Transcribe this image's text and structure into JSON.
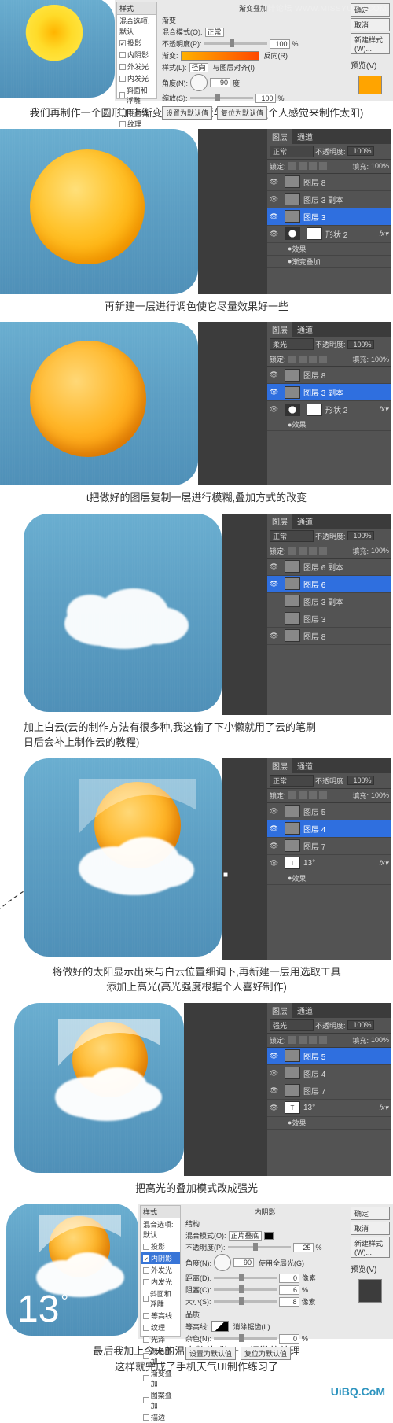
{
  "watermark": "思缘设计论坛  WWW.MISSYUAN.COM",
  "footer_site": "UiBQ.CoM",
  "captions": {
    "c1": "我们再制作一个圆形加上渐变色使它接近与太阳颜色(个人感觉来制作太阳)",
    "c2": "再新建一层进行调色使它尽量效果好一些",
    "c3": "t把做好的图层复制一层进行模糊,叠加方式的改变",
    "c4a": "加上白云(云的制作方法有很多种,我这偷了下小懒就用了云的笔刷",
    "c4b": "日后会补上制作云的教程)",
    "c5a": "将做好的太阳显示出来与白云位置细调下,再新建一层用选取工具",
    "c5b": "添加上高光(高光强度根据个人喜好制作)",
    "c6": "把高光的叠加模式改成强光",
    "c7a": "最后我加上今天的温度数值,做一下细微的处理",
    "c7b": "这样就完成了手机天气UI制作练习了"
  },
  "temp_value": "13",
  "style_panel": {
    "col_header": "样式",
    "group_header": "混合选项:默认",
    "items": [
      "投影",
      "内阴影",
      "外发光",
      "内发光",
      "斜面和浮雕",
      "等高线",
      "纹理",
      "光泽",
      "颜色叠加",
      "渐变叠加",
      "图案叠加",
      "描边"
    ],
    "checked": [
      true,
      false,
      false,
      false,
      false,
      false,
      false,
      false,
      false,
      true,
      false,
      false
    ],
    "selected_index": 9,
    "title_gradient": "渐变叠加",
    "section_gradient": "渐变",
    "blend_label": "混合模式(O):",
    "blend_value": "正常",
    "opacity_label": "不透明度(P):",
    "opacity_value": "100",
    "gradient_label": "渐变:",
    "reverse_label": "反向(R)",
    "style_label": "样式(L):",
    "style_value": "径向",
    "align_label": "与图层对齐(I)",
    "angle_label": "角度(N):",
    "angle_value": "90",
    "angle_unit": "度",
    "scale_label": "缩放(S):",
    "scale_value": "100",
    "btn_default": "设置为默认值",
    "btn_reset": "复位为默认值",
    "side_ok": "确定",
    "side_cancel": "取消",
    "side_new": "新建样式(W)...",
    "side_preview": "预览(V)",
    "title_innershadow": "内阴影",
    "section_struct": "结构",
    "is_blend_value": "正片叠底",
    "is_opacity": "25",
    "is_angle": "90",
    "is_global": "使用全局光(G)",
    "is_dist_label": "距离(D):",
    "is_dist": "0",
    "is_px": "像素",
    "is_choke_label": "阻塞(C):",
    "is_choke": "6",
    "is_size_label": "大小(S):",
    "is_size": "8",
    "is_quality": "品质",
    "is_contour": "等高线:",
    "is_aa": "消除锯齿(L)",
    "is_noise_label": "杂色(N):",
    "is_noise": "0"
  },
  "layers": {
    "tab1": "图层",
    "tab2": "通道",
    "blend_normal": "正常",
    "blend_highlight": "强光",
    "blend_rouguang": "柔光",
    "opacity_label": "不透明度:",
    "opacity": "100%",
    "lock_label": "锁定:",
    "fill_label": "填充:",
    "fill": "100%",
    "p2": {
      "l1": "图层 8",
      "l2": "图层 3 副本",
      "l3": "图层 3",
      "shape": "形状 2",
      "fx_label": "效果",
      "fx_item": "渐变叠加"
    },
    "p3": {
      "l1": "图层 8",
      "l2": "图层 3 副本",
      "shape": "形状 2",
      "fx_label": "效果"
    },
    "p4": {
      "l1": "图层 6 副本",
      "l2": "图层 6",
      "l3": "图层 3 副本",
      "l4": "图层 3",
      "l5": "图层 8"
    },
    "p5": {
      "l1": "图层 5",
      "l2": "图层 4",
      "l3": "图层 7",
      "l4": "13°",
      "fx_label": "效果"
    },
    "p6": {
      "l1": "图层 5",
      "l2": "图层 4",
      "l3": "图层 7",
      "l4": "13°",
      "fx_label": "效果"
    }
  }
}
